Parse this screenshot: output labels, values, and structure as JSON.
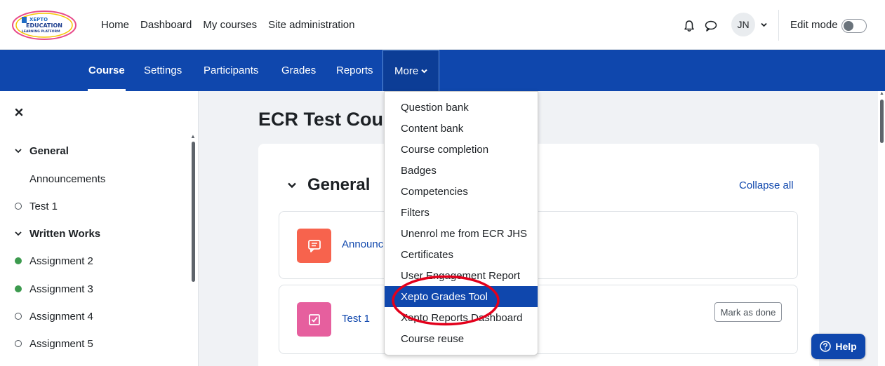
{
  "logo": {
    "lines": [
      "XEPTO",
      "EDUCATION",
      "LEARNING PLATFORM"
    ]
  },
  "topnav": {
    "items": [
      "Home",
      "Dashboard",
      "My courses",
      "Site administration"
    ]
  },
  "user": {
    "initials": "JN",
    "edit_mode_label": "Edit mode",
    "edit_mode_on": false
  },
  "secondary_nav": {
    "tabs": [
      "Course",
      "Settings",
      "Participants",
      "Grades",
      "Reports"
    ],
    "active": "Course",
    "more_label": "More"
  },
  "more_menu": {
    "items": [
      "Question bank",
      "Content bank",
      "Course completion",
      "Badges",
      "Competencies",
      "Filters",
      "Unenrol me from ECR JHS",
      "Certificates",
      "User Engagement Report",
      "Xepto Grades Tool",
      "Xepto Reports Dashboard",
      "Course reuse"
    ],
    "highlighted": "Xepto Grades Tool"
  },
  "drawer": {
    "items": [
      {
        "label": "General",
        "type": "section"
      },
      {
        "label": "Announcements",
        "type": "item-noicon"
      },
      {
        "label": "Test 1",
        "type": "open"
      },
      {
        "label": "Written Works",
        "type": "section"
      },
      {
        "label": "Assignment 2",
        "type": "done"
      },
      {
        "label": "Assignment 3",
        "type": "done"
      },
      {
        "label": "Assignment 4",
        "type": "open"
      },
      {
        "label": "Assignment 5",
        "type": "open"
      }
    ]
  },
  "main": {
    "course_title": "ECR Test Cou",
    "section_title": "General",
    "collapse_all": "Collapse all",
    "activities": [
      {
        "name": "Announce",
        "icon": "forum-icon",
        "color": "#f7634d"
      },
      {
        "name": "Test 1",
        "icon": "quiz-icon",
        "color": "#e65f9e",
        "button": "Mark as done"
      }
    ]
  },
  "help": {
    "label": "Help"
  },
  "colors": {
    "brand": "#0f47ad",
    "annotation": "#e3001b"
  }
}
